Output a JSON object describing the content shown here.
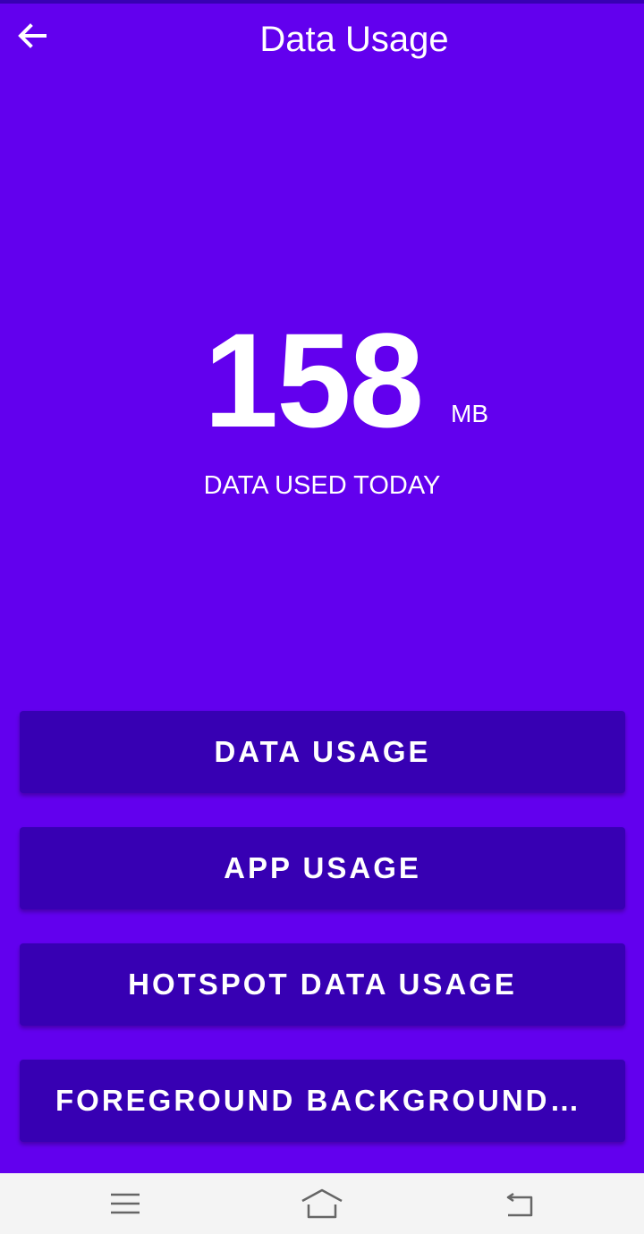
{
  "app_bar": {
    "title": "Data Usage",
    "back_icon": "arrow-left-icon"
  },
  "usage": {
    "amount": "158",
    "unit": "MB",
    "caption": "DATA USED TODAY"
  },
  "buttons": [
    {
      "label": "DATA USAGE"
    },
    {
      "label": "APP USAGE"
    },
    {
      "label": "HOTSPOT DATA USAGE"
    },
    {
      "label": "FOREGROUND BACKGROUND U…"
    }
  ],
  "nav_bar": {
    "icons": [
      "menu-icon",
      "home-icon",
      "back-icon"
    ]
  },
  "colors": {
    "background": "#6200EE",
    "button": "#3700B3",
    "text": "#FFFFFF",
    "nav_bar": "#F4F4F4"
  }
}
